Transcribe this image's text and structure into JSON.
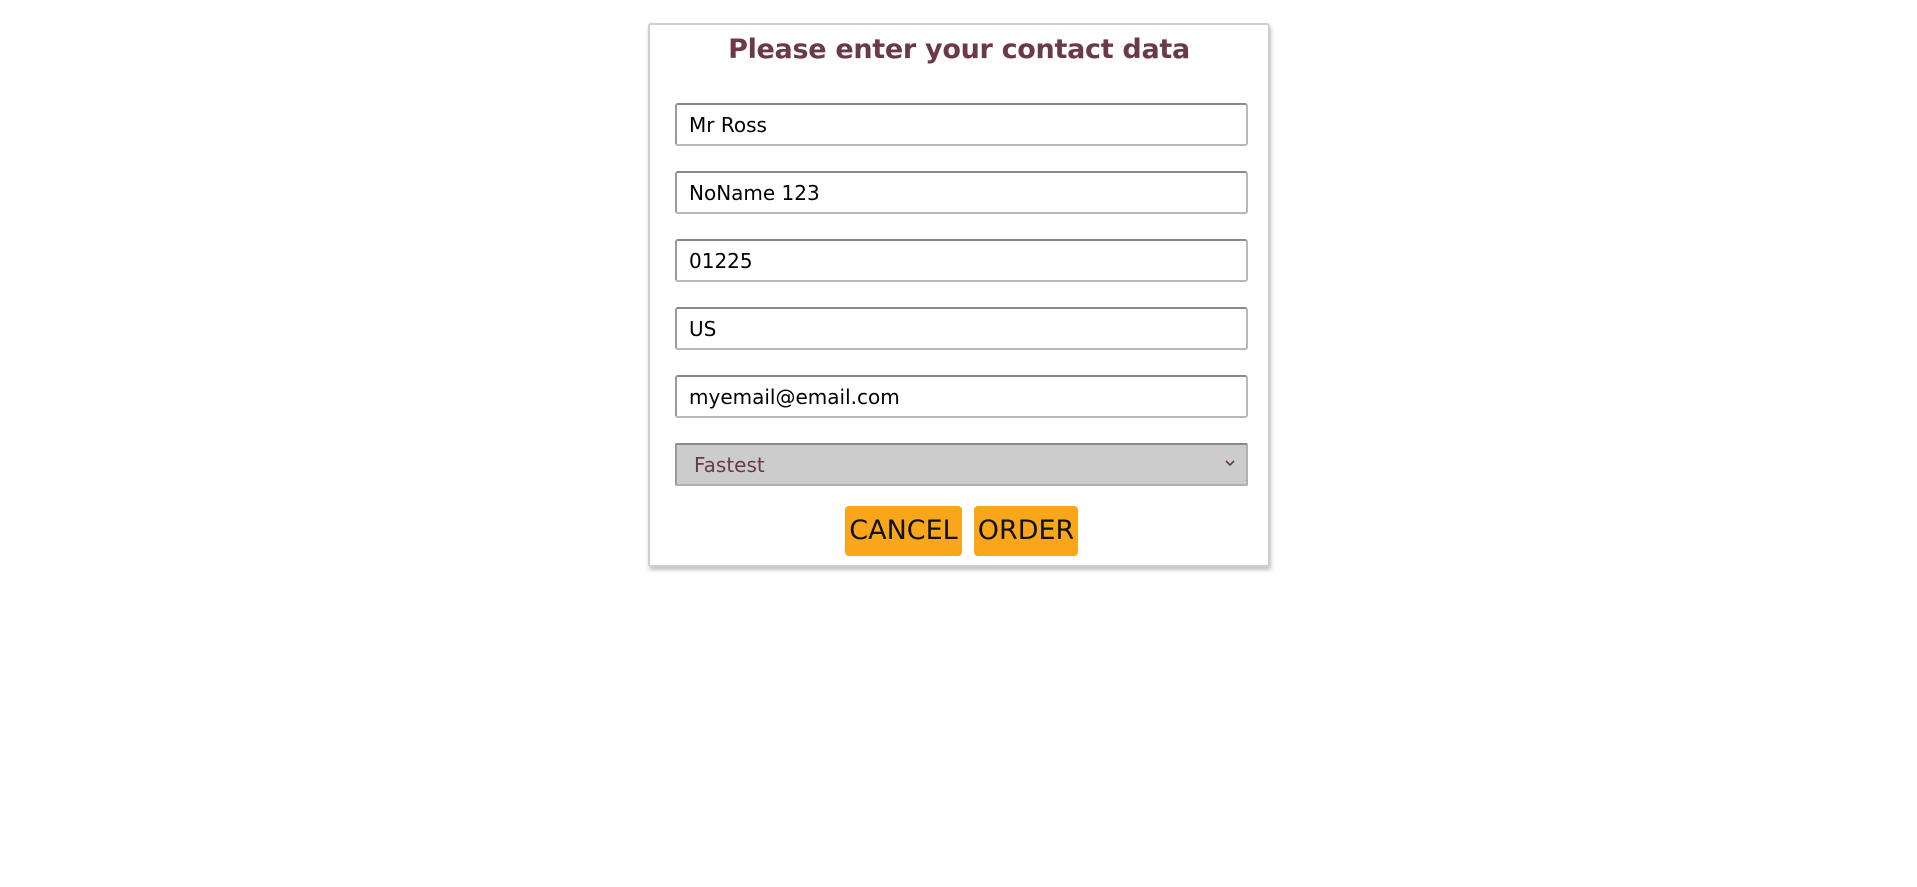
{
  "dialog": {
    "title": "Please enter your contact data",
    "fields": [
      {
        "value": "Mr Ross"
      },
      {
        "value": "NoName 123"
      },
      {
        "value": "01225"
      },
      {
        "value": "US"
      },
      {
        "value": "myemail@email.com"
      }
    ],
    "shipping_select": {
      "selected": "Fastest",
      "icon": "chevron-down-icon"
    },
    "buttons": {
      "cancel_label": "CANCEL",
      "order_label": "ORDER"
    }
  },
  "colors": {
    "title": "#6b3a49",
    "button_background": "#f9a61a",
    "select_background": "#cccccc"
  }
}
